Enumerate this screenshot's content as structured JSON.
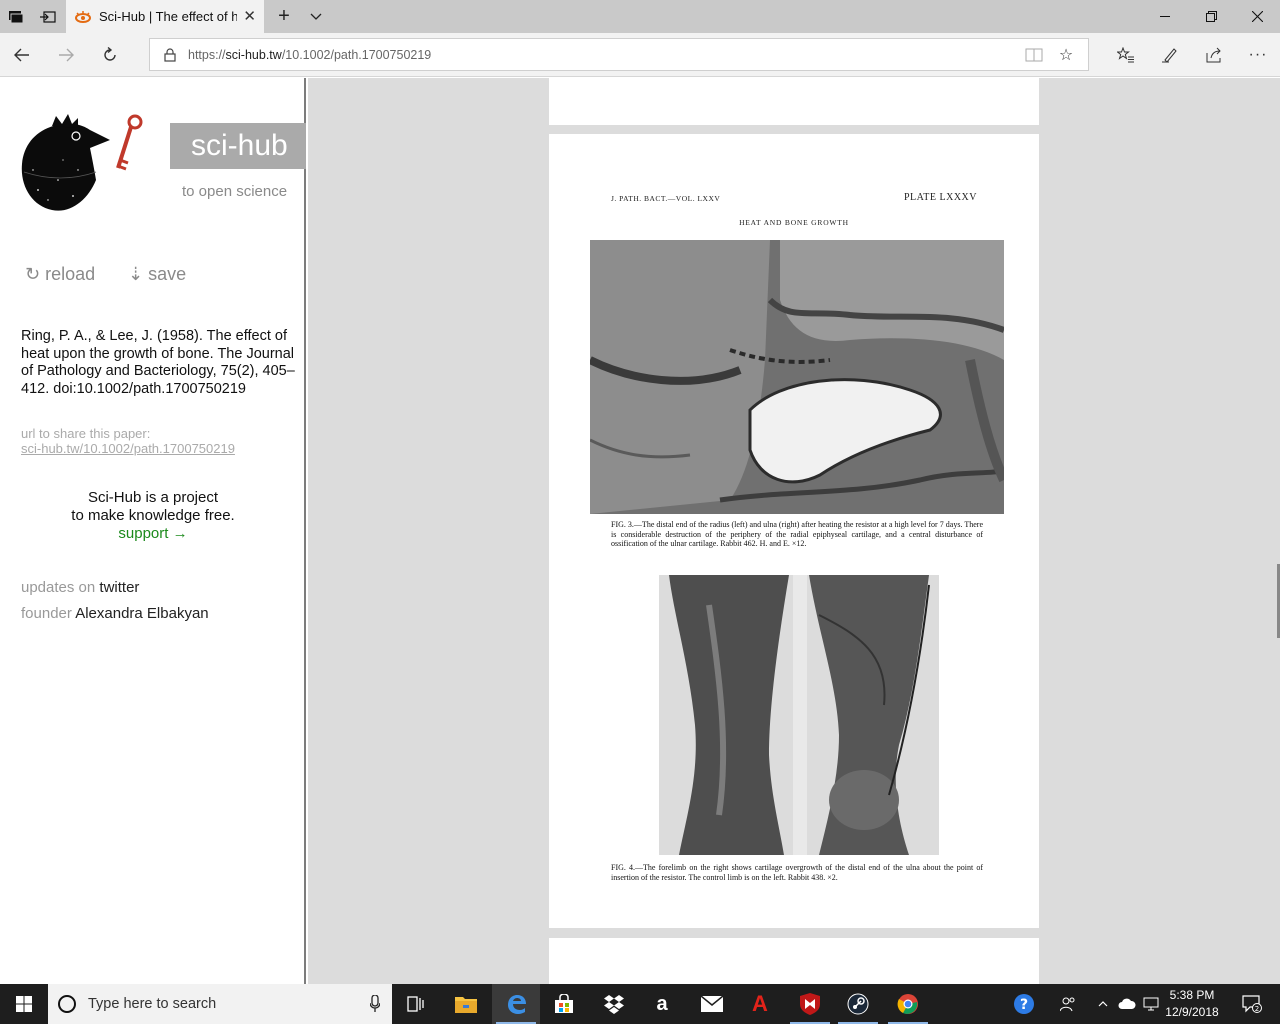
{
  "browser": {
    "tab": {
      "title": "Sci-Hub | The effect of h"
    },
    "url": {
      "prefix": "https://",
      "domain": "sci-hub.tw",
      "path": "/10.1002/path.1700750219"
    }
  },
  "sidebar": {
    "brand": "sci-hub",
    "tagline": "to open science",
    "reload": "↻ reload",
    "save": "⇣ save",
    "citation": "Ring, P. A., & Lee, J. (1958). The effect of heat upon the growth of bone. The Journal of Pathology and Bacteriology, 75(2), 405–412. doi:10.1002/path.1700750219",
    "share_label": "url to share this paper:",
    "share_link": "sci-hub.tw/10.1002/path.1700750219",
    "project_line1": "Sci-Hub is a project",
    "project_line2": "to make knowledge free.",
    "support": "support →",
    "updates_label": "updates on",
    "updates_link": "twitter",
    "founder_label": "founder",
    "founder_name": "Alexandra Elbakyan"
  },
  "document": {
    "journal_header": "J. PATH. BACT.—VOL. LXXV",
    "plate": "PLATE LXXXV",
    "running_title": "HEAT AND BONE GROWTH",
    "fig3_caption": "FIG. 3.—The distal end of the radius (left) and ulna (right) after heating the resistor at a high level for 7 days. There is considerable destruction of the periphery of the radial epiphyseal cartilage, and a central disturbance of ossification of the ulnar cartilage. Rabbit 462. H. and E. ×12.",
    "fig4_caption": "FIG. 4.—The forelimb on the right shows cartilage overgrowth of the distal end of the ulna about the point of insertion of the resistor. The control limb is on the left. Rabbit 438. ×2."
  },
  "taskbar": {
    "search_placeholder": "Type here to search",
    "time": "5:38 PM",
    "date": "12/9/2018",
    "notifications": "2"
  }
}
